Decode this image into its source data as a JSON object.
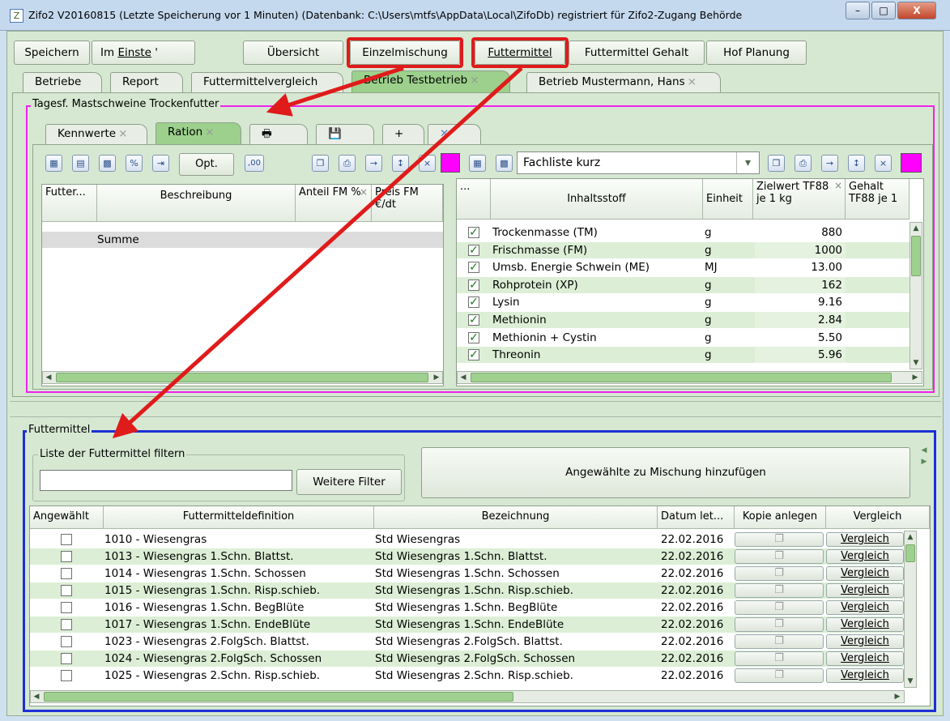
{
  "window": {
    "title": "Zifo2 V20160815 (Letzte Speicherung vor 1 Minuten) (Datenbank: C:\\Users\\mtfs\\AppData\\Local\\ZifoDb) registriert für Zifo2-Zugang Behörde",
    "minimize": "–",
    "maximize": "□",
    "close": "X"
  },
  "toolbar": {
    "save": "Speichern",
    "import_prefix": "Im",
    "settings": "Einste",
    "overview": "Übersicht",
    "single_mix": "Einzelmischung",
    "feed": "Futtermittel",
    "feed_content": "Futtermittel Gehalt",
    "farm_planning": "Hof Planung"
  },
  "main_tabs": [
    {
      "label": "Betriebe"
    },
    {
      "label": "Report"
    },
    {
      "label": "Futtermittelvergleich"
    },
    {
      "label": "Betrieb Testbetrieb",
      "close": "×"
    },
    {
      "label": "Betrieb Mustermann, Hans",
      "close": "×"
    }
  ],
  "ration_group": {
    "legend": "Tagesf. Mastschweine Trockenfutter",
    "tabs": [
      {
        "label": "Kennwerte",
        "close": "×"
      },
      {
        "label": "Ration",
        "close": "×"
      },
      {
        "label": "🖶"
      },
      {
        "label": "💾"
      },
      {
        "label": "+"
      },
      {
        "label": "✕"
      }
    ],
    "left_toolbar": {
      "opt": "Opt.",
      "decimals": ",00"
    },
    "left_headers": [
      "Futter...",
      "Beschreibung",
      "Anteil FM %",
      "Preis FM €/dt"
    ],
    "left_header_close": "×",
    "sum_row": "Summe",
    "right_select": "Fachliste kurz",
    "right_headers": {
      "dots": "...",
      "nutrient": "Inhaltsstoff",
      "unit": "Einheit",
      "target": "Zielwert TF88 je 1 kg",
      "content": "Gehalt TF88 je 1"
    },
    "right_header_close": "×",
    "nutrients": [
      {
        "name": "Trockenmasse (TM)",
        "unit": "g",
        "target": "880"
      },
      {
        "name": "Frischmasse (FM)",
        "unit": "g",
        "target": "1000"
      },
      {
        "name": "Umsb. Energie Schwein (ME)",
        "unit": "MJ",
        "target": "13.00"
      },
      {
        "name": "Rohprotein (XP)",
        "unit": "g",
        "target": "162"
      },
      {
        "name": "Lysin",
        "unit": "g",
        "target": "9.16"
      },
      {
        "name": "Methionin",
        "unit": "g",
        "target": "2.84"
      },
      {
        "name": "Methionin + Cystin",
        "unit": "g",
        "target": "5.50"
      },
      {
        "name": "Threonin",
        "unit": "g",
        "target": "5.96"
      }
    ]
  },
  "feed_group": {
    "legend": "Futtermittel",
    "filter_legend": "Liste der Futtermittel filtern",
    "filter_value": "",
    "more_filters": "Weitere Filter",
    "add_selected": "Angewählte zu Mischung hinzufügen",
    "headers": [
      "Angewählt",
      "Futtermitteldefinition",
      "Bezeichnung",
      "Datum let...",
      "Kopie anlegen",
      "Vergleich"
    ],
    "compare_label": "Vergleich",
    "rows": [
      {
        "def": "1010 - Wiesengras",
        "name": "Std Wiesengras",
        "date": "22.02.2016"
      },
      {
        "def": "1013 - Wiesengras 1.Schn. Blattst.",
        "name": "Std Wiesengras 1.Schn. Blattst.",
        "date": "22.02.2016"
      },
      {
        "def": "1014 - Wiesengras 1.Schn. Schossen",
        "name": "Std Wiesengras 1.Schn. Schossen",
        "date": "22.02.2016"
      },
      {
        "def": "1015 - Wiesengras 1.Schn. Risp.schieb.",
        "name": "Std Wiesengras 1.Schn. Risp.schieb.",
        "date": "22.02.2016"
      },
      {
        "def": "1016 - Wiesengras 1.Schn. BegBlüte",
        "name": "Std Wiesengras 1.Schn. BegBlüte",
        "date": "22.02.2016"
      },
      {
        "def": "1017 - Wiesengras 1.Schn. EndeBlüte",
        "name": "Std Wiesengras 1.Schn. EndeBlüte",
        "date": "22.02.2016"
      },
      {
        "def": "1023 - Wiesengras 2.FolgSch. Blattst.",
        "name": "Std Wiesengras 2.FolgSch. Blattst.",
        "date": "22.02.2016"
      },
      {
        "def": "1024 - Wiesengras 2.FolgSch. Schossen",
        "name": "Std Wiesengras 2.FolgSch. Schossen",
        "date": "22.02.2016"
      },
      {
        "def": "1025 - Wiesengras 2.Schn. Risp.schieb.",
        "name": "Std Wiesengras 2.Schn. Risp.schieb.",
        "date": "22.02.2016"
      }
    ]
  },
  "colors": {
    "highlight": "#e01b1b",
    "ration_border": "#ee22ee",
    "feed_border": "#1d2fd6",
    "active_tab": "#9cd08c",
    "swatch": "#ff00ff"
  }
}
